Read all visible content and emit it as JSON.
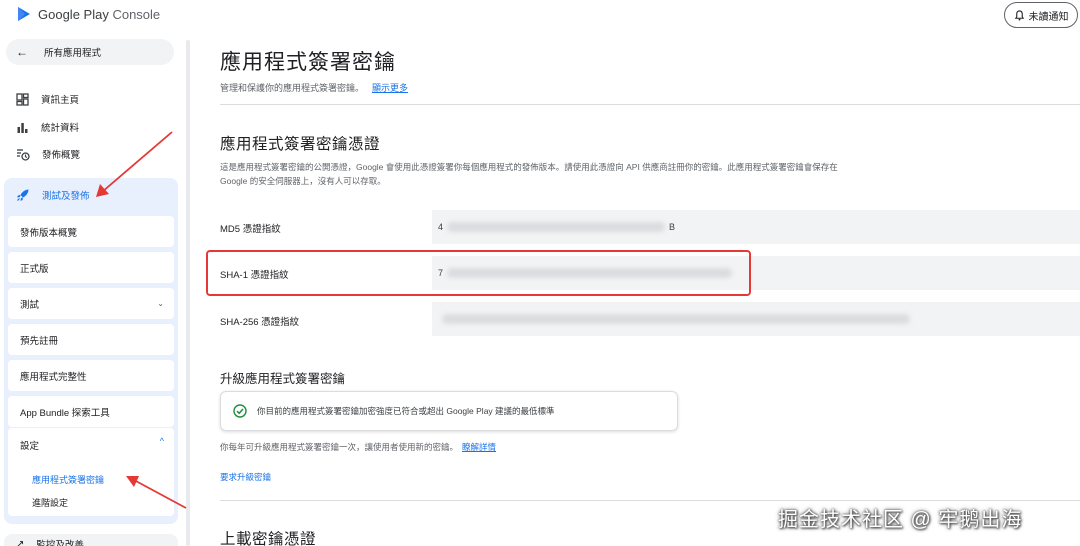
{
  "header": {
    "logo_google": "Google Play",
    "logo_console": "Console",
    "notification_label": "未讀通知"
  },
  "sidebar": {
    "back_label": "所有應用程式",
    "items": [
      {
        "label": "資訊主頁",
        "icon": "dashboard-icon"
      },
      {
        "label": "統計資料",
        "icon": "bar-chart-icon"
      },
      {
        "label": "發佈概覽",
        "icon": "publish-history-icon"
      }
    ],
    "group": {
      "label": "測試及發佈",
      "icon": "rocket-icon",
      "items": [
        "發佈版本概覽",
        "正式版",
        "測試",
        "預先註冊",
        "應用程式完整性",
        "App Bundle 探索工具"
      ],
      "settings": {
        "label": "設定",
        "items": [
          "應用程式簽署密鑰",
          "進階設定"
        ]
      }
    },
    "bottom_item": "監控及改善"
  },
  "main": {
    "title": "應用程式簽署密鑰",
    "subtitle": "管理和保護你的應用程式簽署密鑰。",
    "subtitle_link": "顯示更多",
    "cert_section": {
      "title": "應用程式簽署密鑰憑證",
      "description": "這是應用程式簽署密鑰的公開憑證，Google 會使用此憑證簽署你每個應用程式的發佈版本。請使用此憑證向 API 供應商註冊你的密鑰。此應用程式簽署密鑰會保存在 Google 的安全伺服器上，沒有人可以存取。",
      "fingerprints": [
        {
          "label": "MD5 憑證指紋",
          "value_start": "4",
          "value_end": "B"
        },
        {
          "label": "SHA-1 憑證指紋",
          "value_start": "7",
          "value_end": ""
        },
        {
          "label": "SHA-256 憑證指紋",
          "value_start": "",
          "value_end": ""
        }
      ]
    },
    "upgrade_section": {
      "title": "升級應用程式簽署密鑰",
      "status": "你目前的應用程式簽署密鑰加密強度已符合或超出 Google Play 建議的最低標準",
      "note": "你每年可升級應用程式簽署密鑰一次，讓使用者使用新的密鑰。",
      "note_link": "瞭解詳情",
      "request_link": "要求升級密鑰"
    },
    "upload_section": {
      "title": "上載密鑰憑證"
    }
  },
  "watermark": "掘金技术社区 @ 牢鹅出海",
  "colors": {
    "accent": "#1a73e8",
    "annotation": "#e53935",
    "success": "#1e8e3e"
  }
}
